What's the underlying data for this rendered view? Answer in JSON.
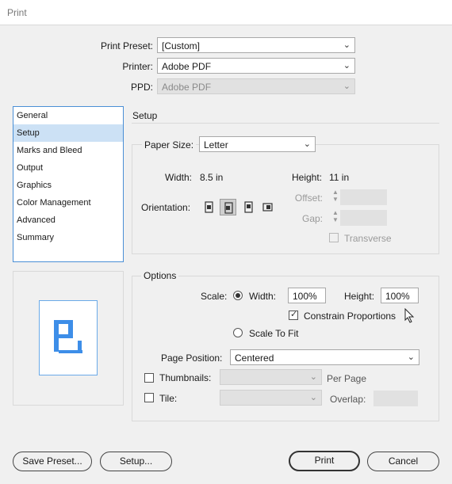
{
  "window": {
    "title": "Print"
  },
  "header": {
    "print_preset_label": "Print Preset:",
    "print_preset_value": "[Custom]",
    "printer_label": "Printer:",
    "printer_value": "Adobe PDF",
    "ppd_label": "PPD:",
    "ppd_value": "Adobe PDF"
  },
  "sidebar": {
    "items": [
      {
        "label": "General"
      },
      {
        "label": "Setup",
        "selected": true
      },
      {
        "label": "Marks and Bleed"
      },
      {
        "label": "Output"
      },
      {
        "label": "Graphics"
      },
      {
        "label": "Color Management"
      },
      {
        "label": "Advanced"
      },
      {
        "label": "Summary"
      }
    ]
  },
  "setup": {
    "section_title": "Setup",
    "paper_size_label": "Paper Size:",
    "paper_size_value": "Letter",
    "width_label": "Width:",
    "width_value": "8.5 in",
    "height_label": "Height:",
    "height_value": "11 in",
    "orientation_label": "Orientation:",
    "offset_label": "Offset:",
    "gap_label": "Gap:",
    "transverse_label": "Transverse"
  },
  "options": {
    "group_title": "Options",
    "scale_label": "Scale:",
    "width_label": "Width:",
    "width_value": "100%",
    "height_label": "Height:",
    "height_value": "100%",
    "constrain_label": "Constrain Proportions",
    "constrain_checked": true,
    "scale_to_fit_label": "Scale To Fit",
    "page_position_label": "Page Position:",
    "page_position_value": "Centered",
    "thumbnails_label": "Thumbnails:",
    "per_page_label": "Per Page",
    "tile_label": "Tile:",
    "overlap_label": "Overlap:"
  },
  "buttons": {
    "save_preset": "Save Preset...",
    "setup": "Setup...",
    "print": "Print",
    "cancel": "Cancel"
  },
  "colors": {
    "accent": "#4a8fd6",
    "selection": "#cce1f5",
    "preview_glyph": "#3d8ee8"
  }
}
